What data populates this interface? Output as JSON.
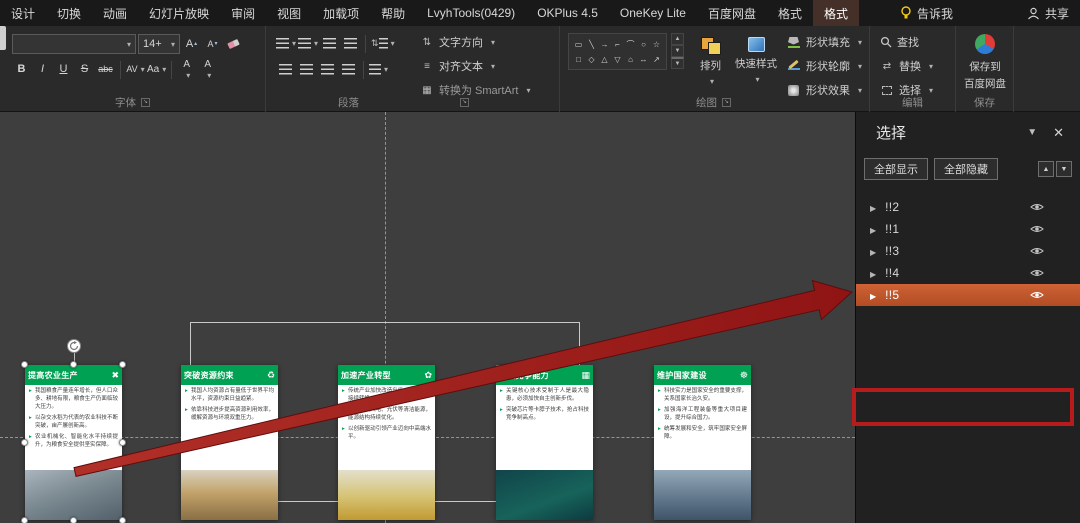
{
  "colors": {
    "accent_green": "#00A152",
    "selection_orange": "#C05A2F",
    "annotation_red": "#B71C1C",
    "ribbon_bg": "#2A2A2A"
  },
  "menubar": {
    "items": [
      "设计",
      "切换",
      "动画",
      "幻灯片放映",
      "审阅",
      "视图",
      "加载项",
      "帮助",
      "LvyhTools(0429)",
      "OKPlus 4.5",
      "OneKey Lite",
      "百度网盘",
      "格式",
      "格式"
    ],
    "tell_me": "告诉我",
    "share": "共享"
  },
  "ribbon": {
    "font": {
      "group_label": "字体",
      "name_value": "",
      "size_value": "14+",
      "bold": "B",
      "italic": "I",
      "underline": "U",
      "strike": "S",
      "strike_abc": "abc",
      "spacing_label": "AV",
      "case_label": "Aa",
      "highlight_label": "A",
      "fontcolor_label": "A"
    },
    "paragraph": {
      "group_label": "段落",
      "text_direction": "文字方向",
      "align_text": "对齐文本",
      "smartart": "转换为 SmartArt"
    },
    "drawing": {
      "group_label": "绘图",
      "arrange": "排列",
      "quick_styles": "快速样式",
      "shape_fill": "形状填充",
      "shape_outline": "形状轮廓",
      "shape_effects": "形状效果",
      "shape_glyphs": [
        "▭",
        "╲",
        "→",
        "⌐",
        "⌒",
        "○",
        "☆",
        "□",
        "◇",
        "△",
        "▽",
        "⌂",
        "↔",
        "↗"
      ]
    },
    "editing": {
      "group_label": "编辑",
      "find": "查找",
      "replace": "替换",
      "select": "选择"
    },
    "save": {
      "group_label": "保存",
      "line1": "保存到",
      "line2": "百度网盘"
    }
  },
  "selection_pane": {
    "title": "选择",
    "show_all": "全部显示",
    "hide_all": "全部隐藏",
    "items": [
      {
        "label": "!!2",
        "highlighted": false
      },
      {
        "label": "!!1",
        "highlighted": false
      },
      {
        "label": "!!3",
        "highlighted": false
      },
      {
        "label": "!!4",
        "highlighted": false
      },
      {
        "label": "!!5",
        "highlighted": true
      }
    ]
  },
  "slide": {
    "cards": [
      {
        "title": "提高农业生产",
        "icon": "✖",
        "bullets": [
          "我国粮食产量连年增长，但人口众多、耕地有限，粮食生产仍面临较大压力。",
          "以杂交水稻为代表的农业科技不断突破，亩产屡创新高。",
          "农业机械化、智能化水平持续提升，为粮食安全提供坚实保障。"
        ]
      },
      {
        "title": "突破资源约束",
        "icon": "♻",
        "bullets": [
          "我国人均资源占有量低于世界平均水平，资源约束日益趋紧。",
          "依靠科技进步提高资源利用效率，缓解资源与环境双重压力。"
        ]
      },
      {
        "title": "加速产业转型",
        "icon": "✿",
        "bullets": [
          "传统产业加快改造升级，新旧动能接续转换。",
          "大力发展风电、光伏等清洁能源，能源结构持续优化。",
          "以创新驱动引领产业迈向中高端水平。"
        ]
      },
      {
        "title": "增强竞争能力",
        "icon": "▦",
        "bullets": [
          "关键核心技术受制于人是最大隐患，必须加快自主创新步伐。",
          "突破芯片等卡脖子技术，抢占科技竞争制高点。"
        ]
      },
      {
        "title": "维护国家建设",
        "icon": "☸",
        "bullets": [
          "科技实力是国家安全的重要支撑，关系国家长治久安。",
          "加强海洋工程装备等重大项目建设，提升综合国力。",
          "统筹发展和安全，筑牢国家安全屏障。"
        ]
      }
    ]
  }
}
